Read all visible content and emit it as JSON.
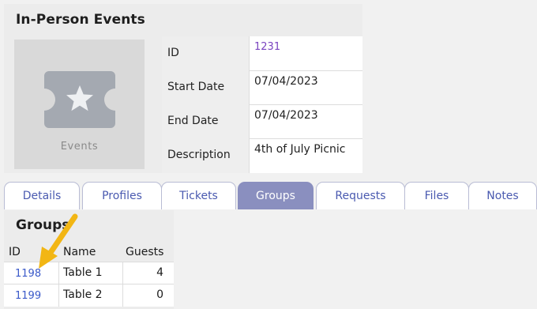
{
  "header": {
    "title": "In-Person Events"
  },
  "thumbnail": {
    "icon": "ticket-star-icon",
    "label": "Events"
  },
  "details": [
    {
      "label": "ID",
      "value": "1231"
    },
    {
      "label": "Start Date",
      "value": "07/04/2023"
    },
    {
      "label": "End Date",
      "value": "07/04/2023"
    },
    {
      "label": "Description",
      "value": "4th of July Picnic"
    }
  ],
  "tabs": [
    {
      "label": "Details"
    },
    {
      "label": "Profiles"
    },
    {
      "label": "Tickets"
    },
    {
      "label": "Groups"
    },
    {
      "label": "Requests"
    },
    {
      "label": "Files"
    },
    {
      "label": "Notes"
    }
  ],
  "active_tab": "Groups",
  "groups": {
    "title": "Groups",
    "columns": [
      "ID",
      "Name",
      "Guests"
    ],
    "rows": [
      {
        "id": "1198",
        "name": "Table 1",
        "guests": "4"
      },
      {
        "id": "1199",
        "name": "Table 2",
        "guests": "0"
      }
    ]
  },
  "colors": {
    "tab_active_bg": "#8a8fbf",
    "tab_text": "#4a5ab0",
    "link_purple": "#7a44c0",
    "link_blue": "#3a59c9",
    "annotation_arrow": "#f2b614"
  }
}
